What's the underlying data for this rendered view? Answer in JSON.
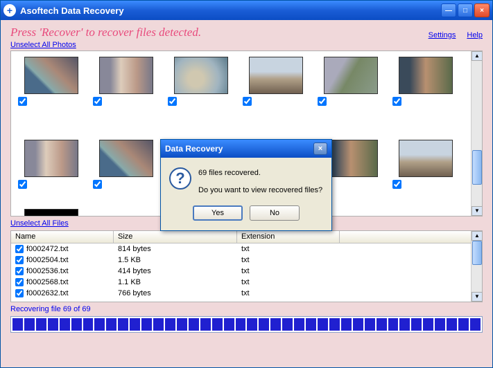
{
  "titlebar": {
    "title": "Asoftech Data Recovery"
  },
  "instruction": "Press 'Recover' to recover files detected.",
  "links": {
    "unselect_photos": "Unselect All Photos",
    "settings": "Settings",
    "help": "Help",
    "unselect_files": "Unselect All Files"
  },
  "files": {
    "headers": {
      "name": "Name",
      "size": "Size",
      "ext": "Extension"
    },
    "rows": [
      {
        "name": "f0002472.txt",
        "size": "814 bytes",
        "ext": "txt"
      },
      {
        "name": "f0002504.txt",
        "size": "1.5 KB",
        "ext": "txt"
      },
      {
        "name": "f0002536.txt",
        "size": "414 bytes",
        "ext": "txt"
      },
      {
        "name": "f0002568.txt",
        "size": "1.1 KB",
        "ext": "txt"
      },
      {
        "name": "f0002632.txt",
        "size": "766 bytes",
        "ext": "txt"
      }
    ]
  },
  "status": "Recovering file 69 of 69",
  "dialog": {
    "title": "Data Recovery",
    "line1": "69 files recovered.",
    "line2": "Do you want to view recovered files?",
    "yes": "Yes",
    "no": "No"
  }
}
